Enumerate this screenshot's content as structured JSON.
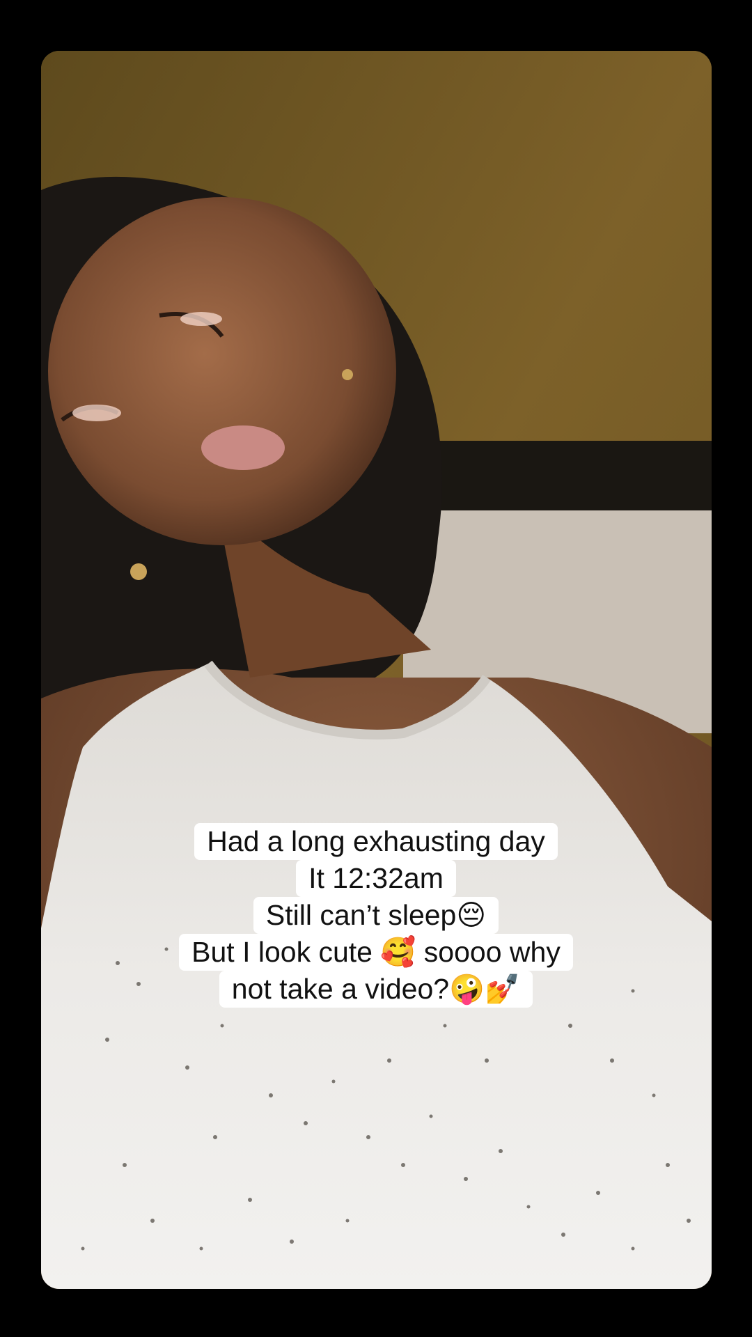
{
  "caption": {
    "lines": [
      "Had a long exhausting day",
      "It 12:32am",
      "Still can’t sleep😔",
      "But I look cute 🥰 soooo why",
      "not take a video?🤪💅"
    ]
  },
  "colors": {
    "background": "#000000",
    "wall": "#7a5f2a",
    "shirt": "#e8e6e3",
    "skin": "#8a5a3c",
    "caption_bg": "#ffffff",
    "caption_text": "#111111"
  }
}
